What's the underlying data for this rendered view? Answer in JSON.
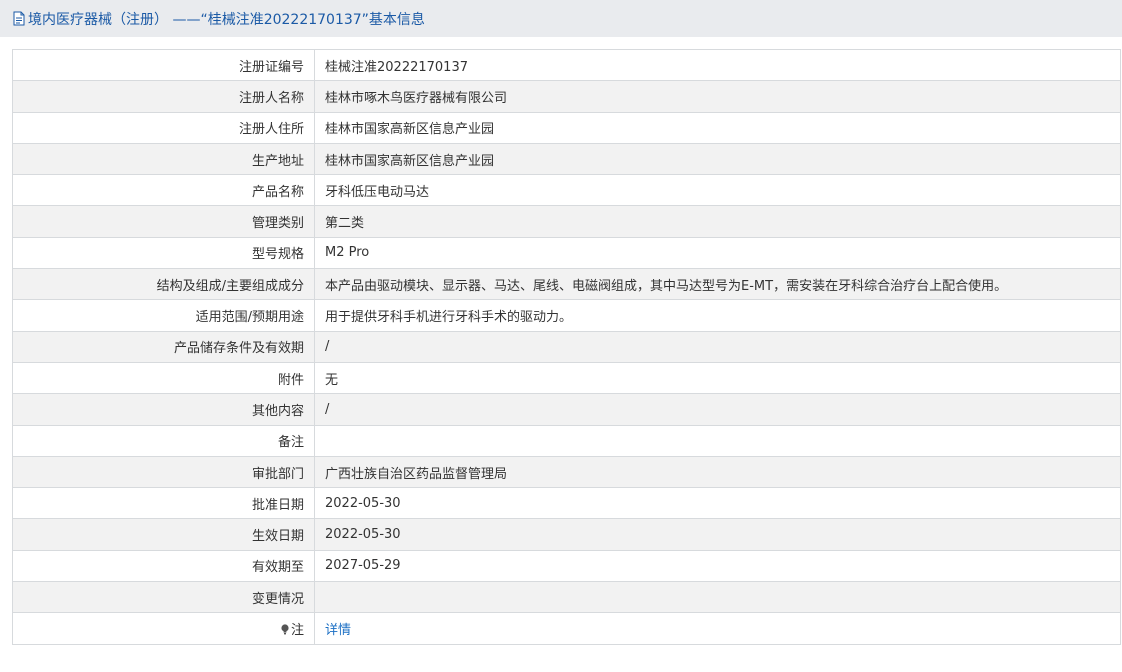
{
  "header": {
    "icon": "document-icon",
    "title": "境内医疗器械（注册） ——“桂械注准20222170137”基本信息"
  },
  "rows": [
    {
      "label": "注册证编号",
      "value": "桂械注准20222170137"
    },
    {
      "label": "注册人名称",
      "value": "桂林市啄木鸟医疗器械有限公司"
    },
    {
      "label": "注册人住所",
      "value": "桂林市国家高新区信息产业园"
    },
    {
      "label": "生产地址",
      "value": "桂林市国家高新区信息产业园"
    },
    {
      "label": "产品名称",
      "value": "牙科低压电动马达"
    },
    {
      "label": "管理类别",
      "value": "第二类"
    },
    {
      "label": "型号规格",
      "value": "M2 Pro"
    },
    {
      "label": "结构及组成/主要组成成分",
      "value": "本产品由驱动模块、显示器、马达、尾线、电磁阀组成，其中马达型号为E-MT，需安装在牙科综合治疗台上配合使用。"
    },
    {
      "label": "适用范围/预期用途",
      "value": "用于提供牙科手机进行牙科手术的驱动力。"
    },
    {
      "label": "产品储存条件及有效期",
      "value": "/"
    },
    {
      "label": "附件",
      "value": "无"
    },
    {
      "label": "其他内容",
      "value": "/"
    },
    {
      "label": "备注",
      "value": ""
    },
    {
      "label": "审批部门",
      "value": "广西壮族自治区药品监督管理局"
    },
    {
      "label": "批准日期",
      "value": "2022-05-30"
    },
    {
      "label": "生效日期",
      "value": "2022-05-30"
    },
    {
      "label": "有效期至",
      "value": "2027-05-29"
    },
    {
      "label": "变更情况",
      "value": ""
    }
  ],
  "note_row": {
    "icon": "lightbulb-icon",
    "label": "注",
    "link_text": "详情"
  },
  "colors": {
    "title_text": "#1b5aa6",
    "link": "#1b6fc4",
    "title_bar_bg": "#e9ebee",
    "row_alt_bg": "#f2f2f2",
    "border": "#d7dadd"
  }
}
